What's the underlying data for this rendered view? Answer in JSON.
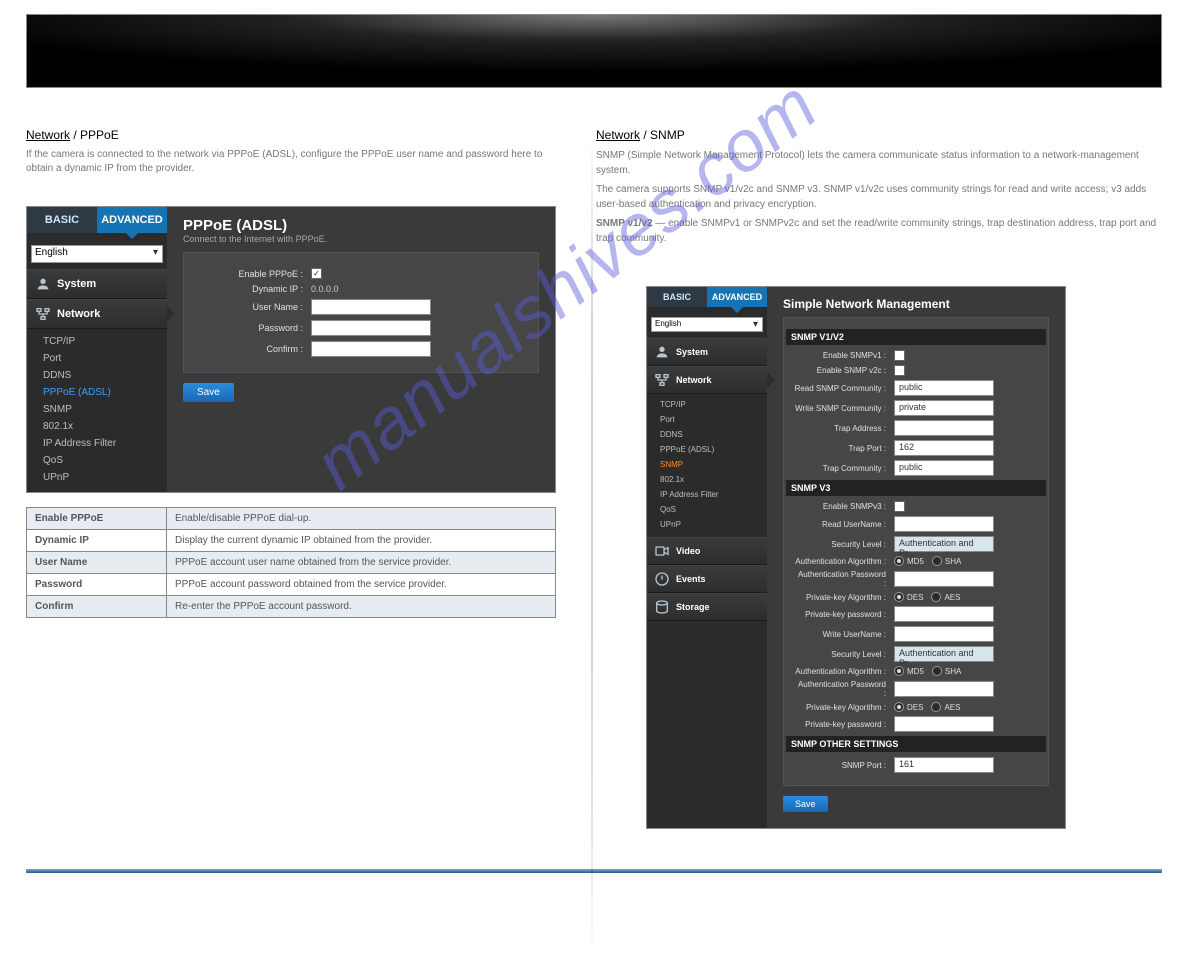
{
  "watermark": "manualshives.com",
  "left": {
    "section_title_underline": "Network",
    "section_title_rest": "  /  PPPoE",
    "intro": "If the camera is connected to the network via PPPoE (ADSL), configure the PPPoE user name and password here to obtain a dynamic IP from the provider.",
    "shot": {
      "tab_basic": "BASIC",
      "tab_adv": "ADVANCED",
      "lang": "English",
      "group_system": "System",
      "group_network": "Network",
      "subs": {
        "tcpip": "TCP/IP",
        "port": "Port",
        "ddns": "DDNS",
        "pppoe": "PPPoE (ADSL)",
        "snmp": "SNMP",
        "dot1x": "802.1x",
        "ipfilter": "IP Address Filter",
        "qos": "QoS",
        "upnp": "UPnP"
      },
      "heading": "PPPoE (ADSL)",
      "subheading": "Connect to the Internet with PPPoE.",
      "rows": {
        "enable": "Enable PPPoE :",
        "dyn": "Dynamic IP :",
        "dyn_val": "0.0.0.0",
        "user": "User Name :",
        "pass": "Password :",
        "confirm": "Confirm :"
      },
      "save": "Save"
    },
    "table": {
      "r1": {
        "h": "Enable PPPoE",
        "d": "Enable/disable PPPoE dial-up."
      },
      "r2": {
        "h": "Dynamic IP",
        "d": "Display the current dynamic IP obtained from the provider."
      },
      "r3": {
        "h": "User Name",
        "d": "PPPoE account user name obtained from the service provider."
      },
      "r4": {
        "h": "Password",
        "d": "PPPoE account password obtained from the service provider."
      },
      "r5": {
        "h": "Confirm",
        "d": "Re-enter the PPPoE account password."
      }
    }
  },
  "right": {
    "section_title_underline": "Network",
    "section_title_rest": "  /  SNMP",
    "body1": "SNMP (Simple Network Management Protocol) lets the camera communicate status information to a network-management system.",
    "body2": "The camera supports SNMP v1/v2c and SNMP v3. SNMP v1/v2c uses community strings for read and write access; v3 adds user-based authentication and privacy encryption.",
    "body3_label": "SNMP v1/v2 ",
    "body3_text": "— enable SNMPv1 or SNMPv2c and set the read/write community strings, trap destination address, trap port and trap community.",
    "shot": {
      "tab_basic": "BASIC",
      "tab_adv": "ADVANCED",
      "lang": "English",
      "groups": {
        "system": "System",
        "network": "Network",
        "video": "Video",
        "events": "Events",
        "storage": "Storage"
      },
      "subs": {
        "tcpip": "TCP/IP",
        "port": "Port",
        "ddns": "DDNS",
        "pppoe": "PPPoE (ADSL)",
        "snmp": "SNMP",
        "dot1x": "802.1x",
        "ipfilter": "IP Address Filter",
        "qos": "QoS",
        "upnp": "UPnP"
      },
      "heading": "Simple Network Management",
      "sec_v12": "SNMP V1/V2",
      "sec_v3": "SNMP V3",
      "sec_other": "SNMP OTHER SETTINGS",
      "rows": {
        "en_v1": "Enable SNMPv1 :",
        "en_v2": "Enable SNMP v2c :",
        "rcomm": "Read SNMP Community :",
        "rcomm_v": "public",
        "wcomm": "Write SNMP Community :",
        "wcomm_v": "private",
        "taddr": "Trap Address :",
        "tport": "Trap Port :",
        "tport_v": "162",
        "tcomm": "Trap Community :",
        "tcomm_v": "public",
        "en_v3": "Enable SNMPv3 :",
        "ruser": "Read UserName :",
        "slevel": "Security Level :",
        "slevel_v": "Authentication and Pr...",
        "aalgo": "Authentication Algorithm :",
        "md5": "MD5",
        "sha": "SHA",
        "apass": "Authentication Password :",
        "pkalgo": "Private-key Algorithm :",
        "des": "DES",
        "aes": "AES",
        "pkpass": "Private-key password :",
        "wuser": "Write UserName :",
        "snmpport": "SNMP Port :",
        "snmpport_v": "161"
      },
      "save": "Save"
    }
  }
}
